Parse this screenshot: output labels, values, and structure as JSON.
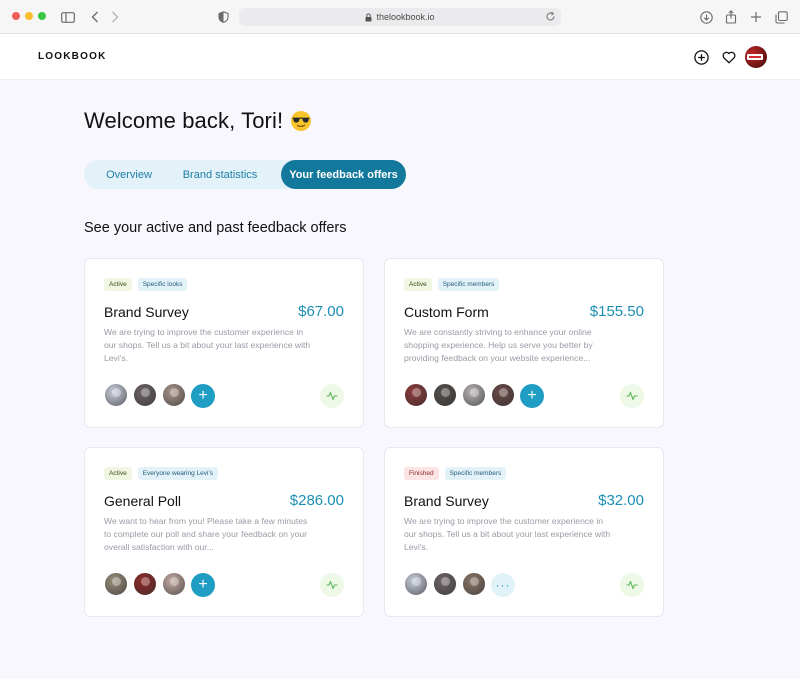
{
  "browser": {
    "url": "thelookbook.io"
  },
  "header": {
    "logo": "LOOKBOOK"
  },
  "main": {
    "welcome": "Welcome back, Tori!",
    "tabs": [
      {
        "label": "Overview"
      },
      {
        "label": "Brand statistics"
      },
      {
        "label": "Your feedback offers",
        "active": true
      }
    ],
    "section_title": "See your active and past feedback offers"
  },
  "offers": [
    {
      "status": "Active",
      "audience": "Specific looks",
      "title": "Brand Survey",
      "price": "$67.00",
      "description": "We are trying to improve the customer experience in our shops. Tell us a bit about your last experience with Levi's.",
      "avatar_colors": [
        "#c9cfdc",
        "#6e6468",
        "#a8948a"
      ],
      "action": "add"
    },
    {
      "status": "Active",
      "audience": "Specific members",
      "title": "Custom Form",
      "price": "$155.50",
      "description": "We are constantly striving to enhance your online shopping experience. Help us serve you better by providing feedback on your website experience...",
      "avatar_colors": [
        "#8c3a3a",
        "#55504c",
        "#b9b3b4",
        "#6b4a48"
      ],
      "action": "add"
    },
    {
      "status": "Active",
      "audience": "Everyone wearing Levi's",
      "title": "General Poll",
      "price": "$286.00",
      "description": "We want to hear from you! Please take a few minutes to complete our poll and share your feedback on your overall satisfaction with our...",
      "avatar_colors": [
        "#9a8f7a",
        "#8e2a2a",
        "#c4a9a2"
      ],
      "action": "add"
    },
    {
      "status": "Finished",
      "audience": "Specific members",
      "title": "Brand Survey",
      "price": "$32.00",
      "description": "We are trying to improve the customer experience in our shops. Tell us a bit about your last experience with Levi's.",
      "avatar_colors": [
        "#c9cfdc",
        "#6e6468",
        "#8a7768"
      ],
      "action": "more"
    }
  ],
  "colors": {
    "accent": "#1a8fb3",
    "tab_active": "#12789c",
    "page_bg": "#f7f7fd"
  }
}
